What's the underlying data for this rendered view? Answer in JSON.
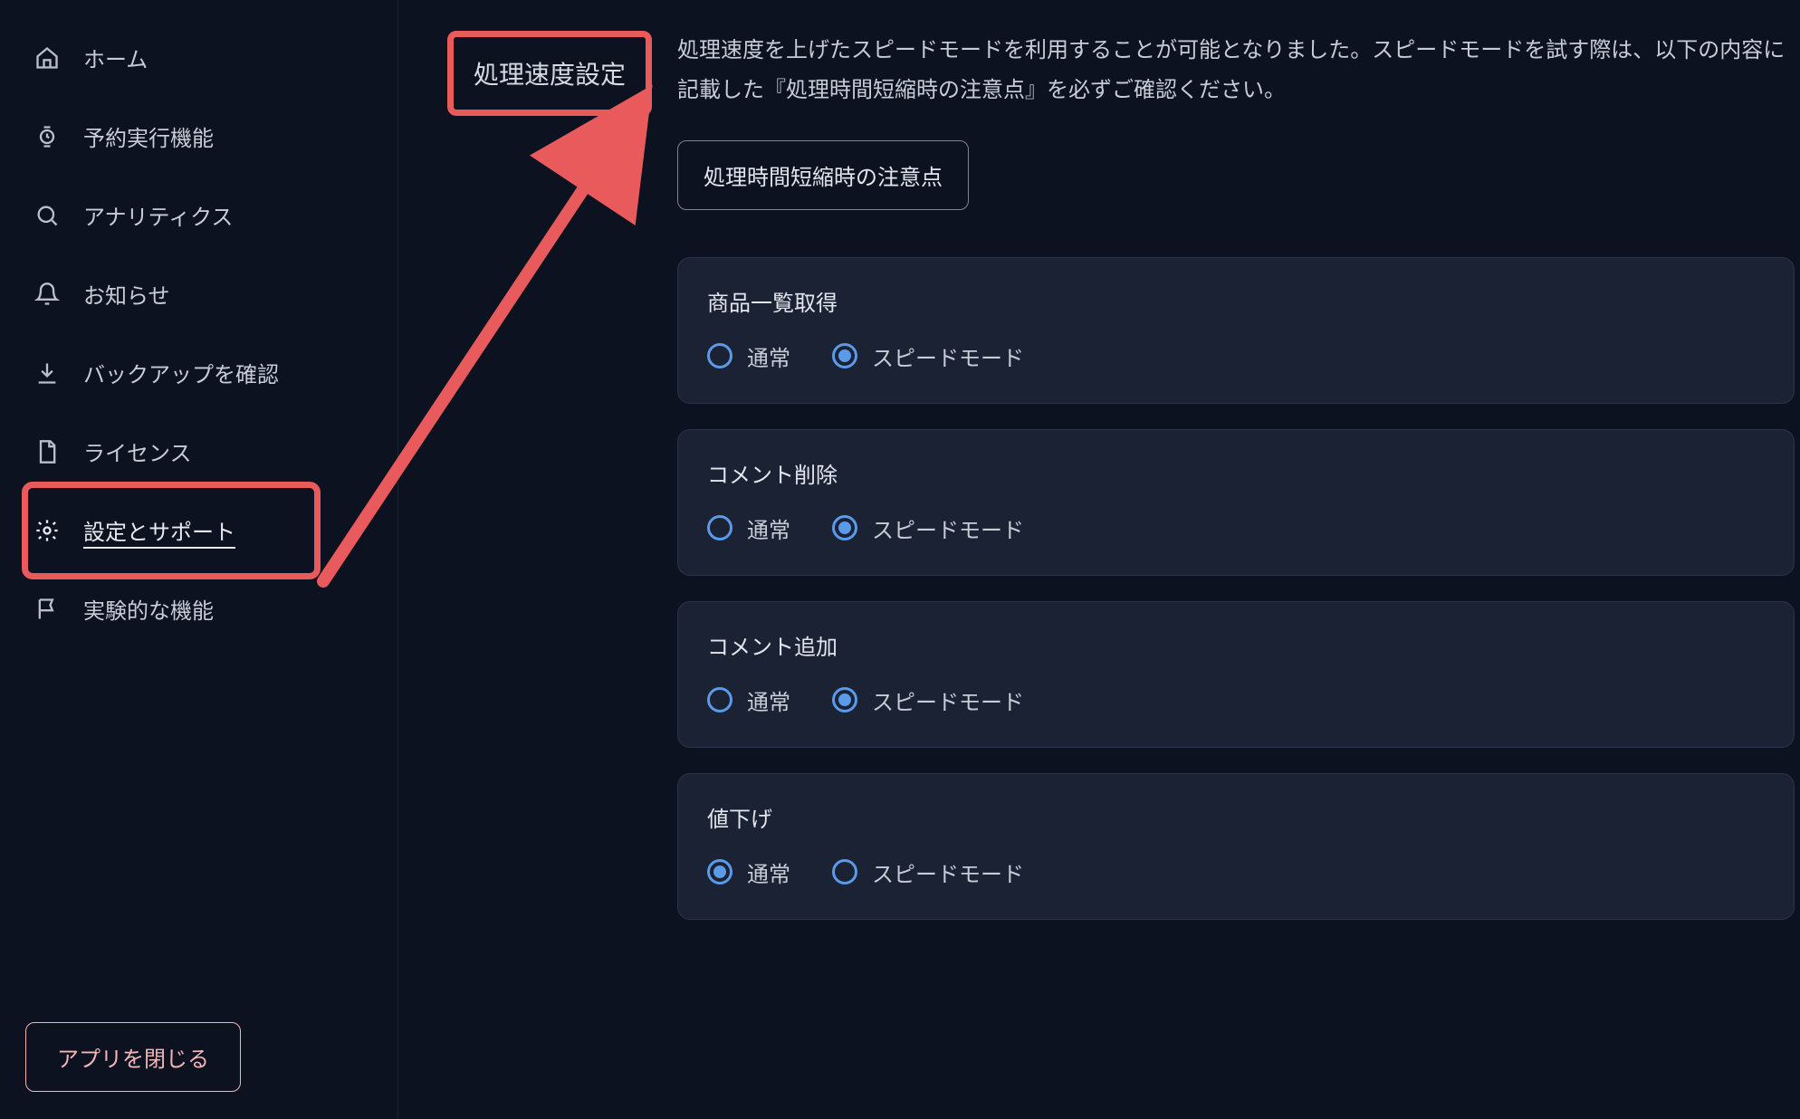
{
  "sidebar": {
    "items": [
      {
        "label": "ホーム",
        "icon": "home"
      },
      {
        "label": "予約実行機能",
        "icon": "watch"
      },
      {
        "label": "アナリティクス",
        "icon": "search"
      },
      {
        "label": "お知らせ",
        "icon": "bell"
      },
      {
        "label": "バックアップを確認",
        "icon": "download"
      },
      {
        "label": "ライセンス",
        "icon": "document"
      },
      {
        "label": "設定とサポート",
        "icon": "gear",
        "active": true
      },
      {
        "label": "実験的な機能",
        "icon": "flag"
      }
    ],
    "close_label": "アプリを閉じる"
  },
  "section": {
    "title": "処理速度設定",
    "description": "処理速度を上げたスピードモードを利用することが可能となりました。スピードモードを試す際は、以下の内容に記載した『処理時間短縮時の注意点』を必ずご確認ください。",
    "info_button": "処理時間短縮時の注意点",
    "option_labels": {
      "normal": "通常",
      "speed": "スピードモード"
    },
    "groups": [
      {
        "title": "商品一覧取得",
        "selected": "speed"
      },
      {
        "title": "コメント削除",
        "selected": "speed"
      },
      {
        "title": "コメント追加",
        "selected": "speed"
      },
      {
        "title": "値下げ",
        "selected": "normal"
      }
    ]
  },
  "colors": {
    "highlight": "#e85a5c",
    "radio": "#5a9ae8",
    "bg": "#0c1220",
    "card": "#1b2233"
  }
}
